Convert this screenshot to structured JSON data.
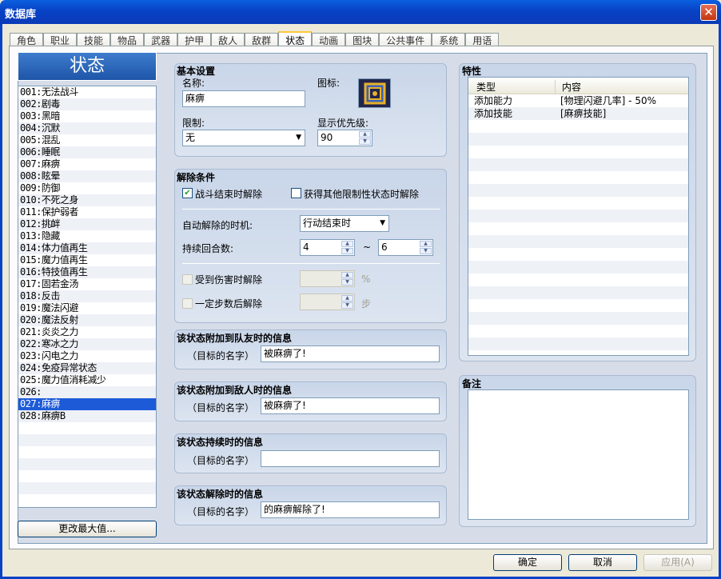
{
  "window": {
    "title": "数据库",
    "close": "✕"
  },
  "tabs": [
    "角色",
    "职业",
    "技能",
    "物品",
    "武器",
    "护甲",
    "敌人",
    "敌群",
    "状态",
    "动画",
    "图块",
    "公共事件",
    "系统",
    "用语"
  ],
  "active_tab": "状态",
  "list": {
    "header": "状态",
    "items": [
      "001:无法战斗",
      "002:剧毒",
      "003:黑暗",
      "004:沉默",
      "005:混乱",
      "006:睡眠",
      "007:麻痹",
      "008:眩晕",
      "009:防御",
      "010:不死之身",
      "011:保护弱者",
      "012:挑衅",
      "013:隐藏",
      "014:体力值再生",
      "015:魔力值再生",
      "016:特技值再生",
      "017:固若金汤",
      "018:反击",
      "019:魔法闪避",
      "020:魔法反射",
      "021:炎炎之力",
      "022:寒冰之力",
      "023:闪电之力",
      "024:免疫异常状态",
      "025:魔力值消耗减少",
      "026:",
      "027:麻痹",
      "028:麻痹B"
    ],
    "selected_index": 26,
    "change_max": "更改最大值..."
  },
  "basic": {
    "title": "基本设置",
    "name_label": "名称:",
    "name_value": "麻痹",
    "icon_label": "图标:",
    "icon_name": "paralysis-state-icon",
    "restriction_label": "限制:",
    "restriction_value": "无",
    "priority_label": "显示优先级:",
    "priority_value": "90"
  },
  "removal": {
    "title": "解除条件",
    "battle_end": "战斗结束时解除",
    "battle_end_checked": true,
    "other_restriction": "获得其他限制性状态时解除",
    "other_restriction_checked": false,
    "timing_label": "自动解除的时机:",
    "timing_value": "行动结束时",
    "turns_label": "持续回合数:",
    "turns_min": "4",
    "turns_tilde": "~",
    "turns_max": "6",
    "damage": "受到伤害时解除",
    "damage_unit": "%",
    "steps": "一定步数后解除",
    "steps_unit": "步"
  },
  "messages": [
    {
      "title": "该状态附加到队友时的信息",
      "prefix": "（目标的名字）",
      "value": "被麻痹了!"
    },
    {
      "title": "该状态附加到敌人时的信息",
      "prefix": "（目标的名字）",
      "value": "被麻痹了!"
    },
    {
      "title": "该状态持续时的信息",
      "prefix": "（目标的名字）",
      "value": ""
    },
    {
      "title": "该状态解除时的信息",
      "prefix": "（目标的名字）",
      "value": "的麻痹解除了!"
    }
  ],
  "features": {
    "title": "特性",
    "col_type": "类型",
    "col_content": "内容",
    "rows": [
      {
        "type": "添加能力",
        "content": "[物理闪避几率] - 50%"
      },
      {
        "type": "添加技能",
        "content": "[麻痹技能]"
      }
    ]
  },
  "notes": {
    "title": "备注"
  },
  "buttons": {
    "ok": "确定",
    "cancel": "取消",
    "apply": "应用(A)"
  },
  "colors": {
    "titlebar": "#0842C5",
    "selection": "#1C5AD8",
    "icon_bg": "#22254A",
    "icon_accent": "#E8B02A"
  }
}
